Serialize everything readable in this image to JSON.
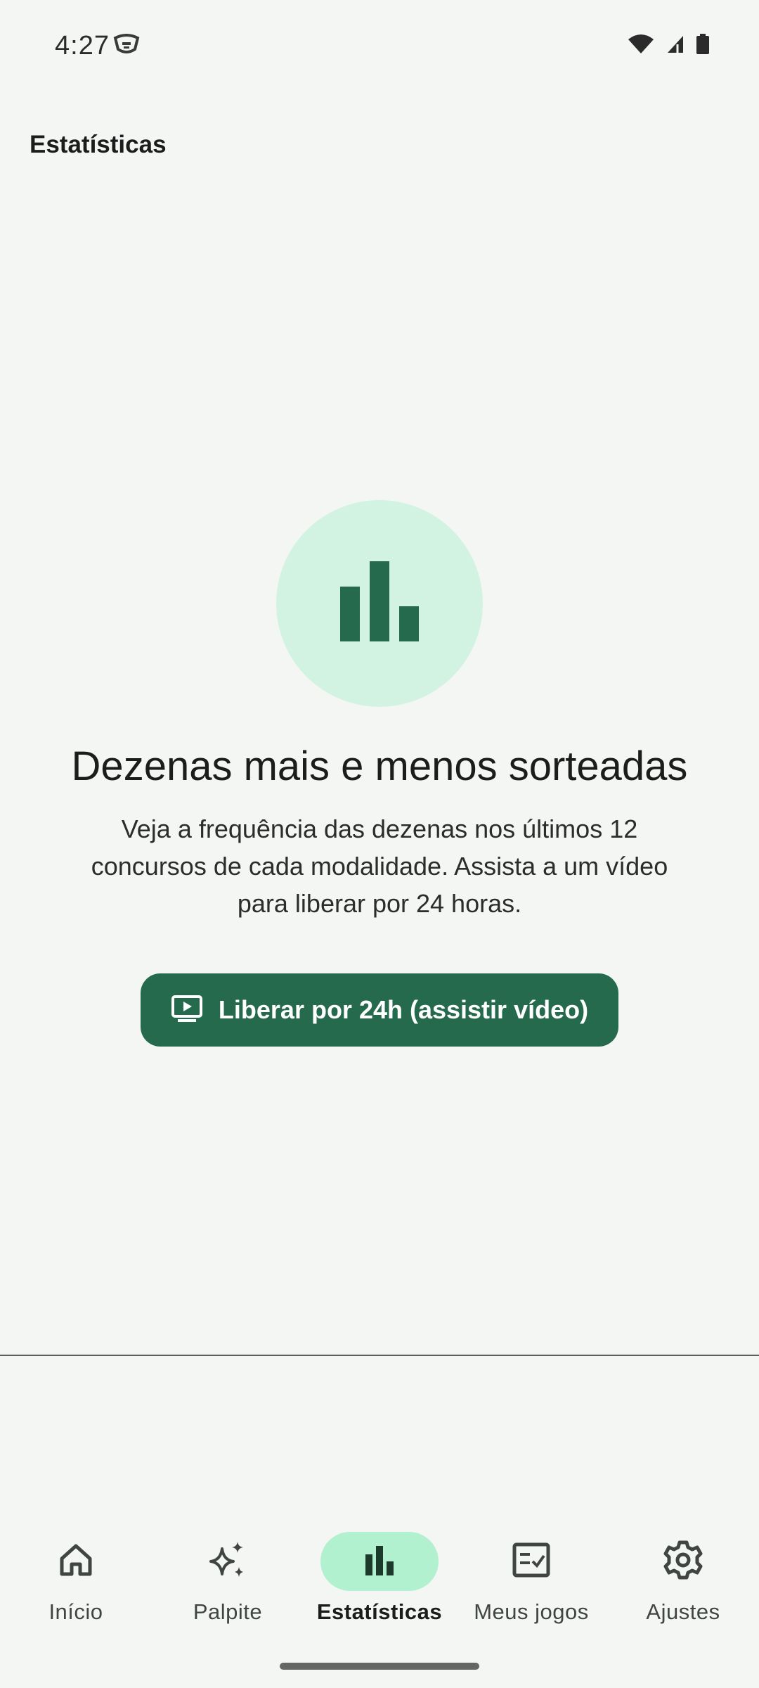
{
  "status_bar": {
    "time": "4:27",
    "icons": [
      "app-notification-icon",
      "wifi-icon",
      "signal-icon",
      "battery-icon"
    ]
  },
  "app_bar": {
    "title": "Estatísticas"
  },
  "empty_state": {
    "icon": "bar-chart-icon",
    "title": "Dezenas mais e menos sorteadas",
    "description": "Veja a frequência das dezenas nos últimos 12 concursos de cada modalidade. Assista a um vídeo para liberar por 24 horas.",
    "button_label": "Liberar por 24h (assistir vídeo)",
    "button_icon": "play-video-icon"
  },
  "bottom_nav": {
    "items": [
      {
        "label": "Início",
        "icon": "home-icon",
        "active": false
      },
      {
        "label": "Palpite",
        "icon": "sparkle-icon",
        "active": false
      },
      {
        "label": "Estatísticas",
        "icon": "bar-chart-icon",
        "active": true
      },
      {
        "label": "Meus jogos",
        "icon": "checklist-icon",
        "active": false
      },
      {
        "label": "Ajustes",
        "icon": "gear-icon",
        "active": false
      }
    ]
  },
  "colors": {
    "background": "#f4f6f4",
    "primary": "#256a4c",
    "primary_container": "#d2f3e2",
    "nav_active_indicator": "#b2f1cf"
  }
}
